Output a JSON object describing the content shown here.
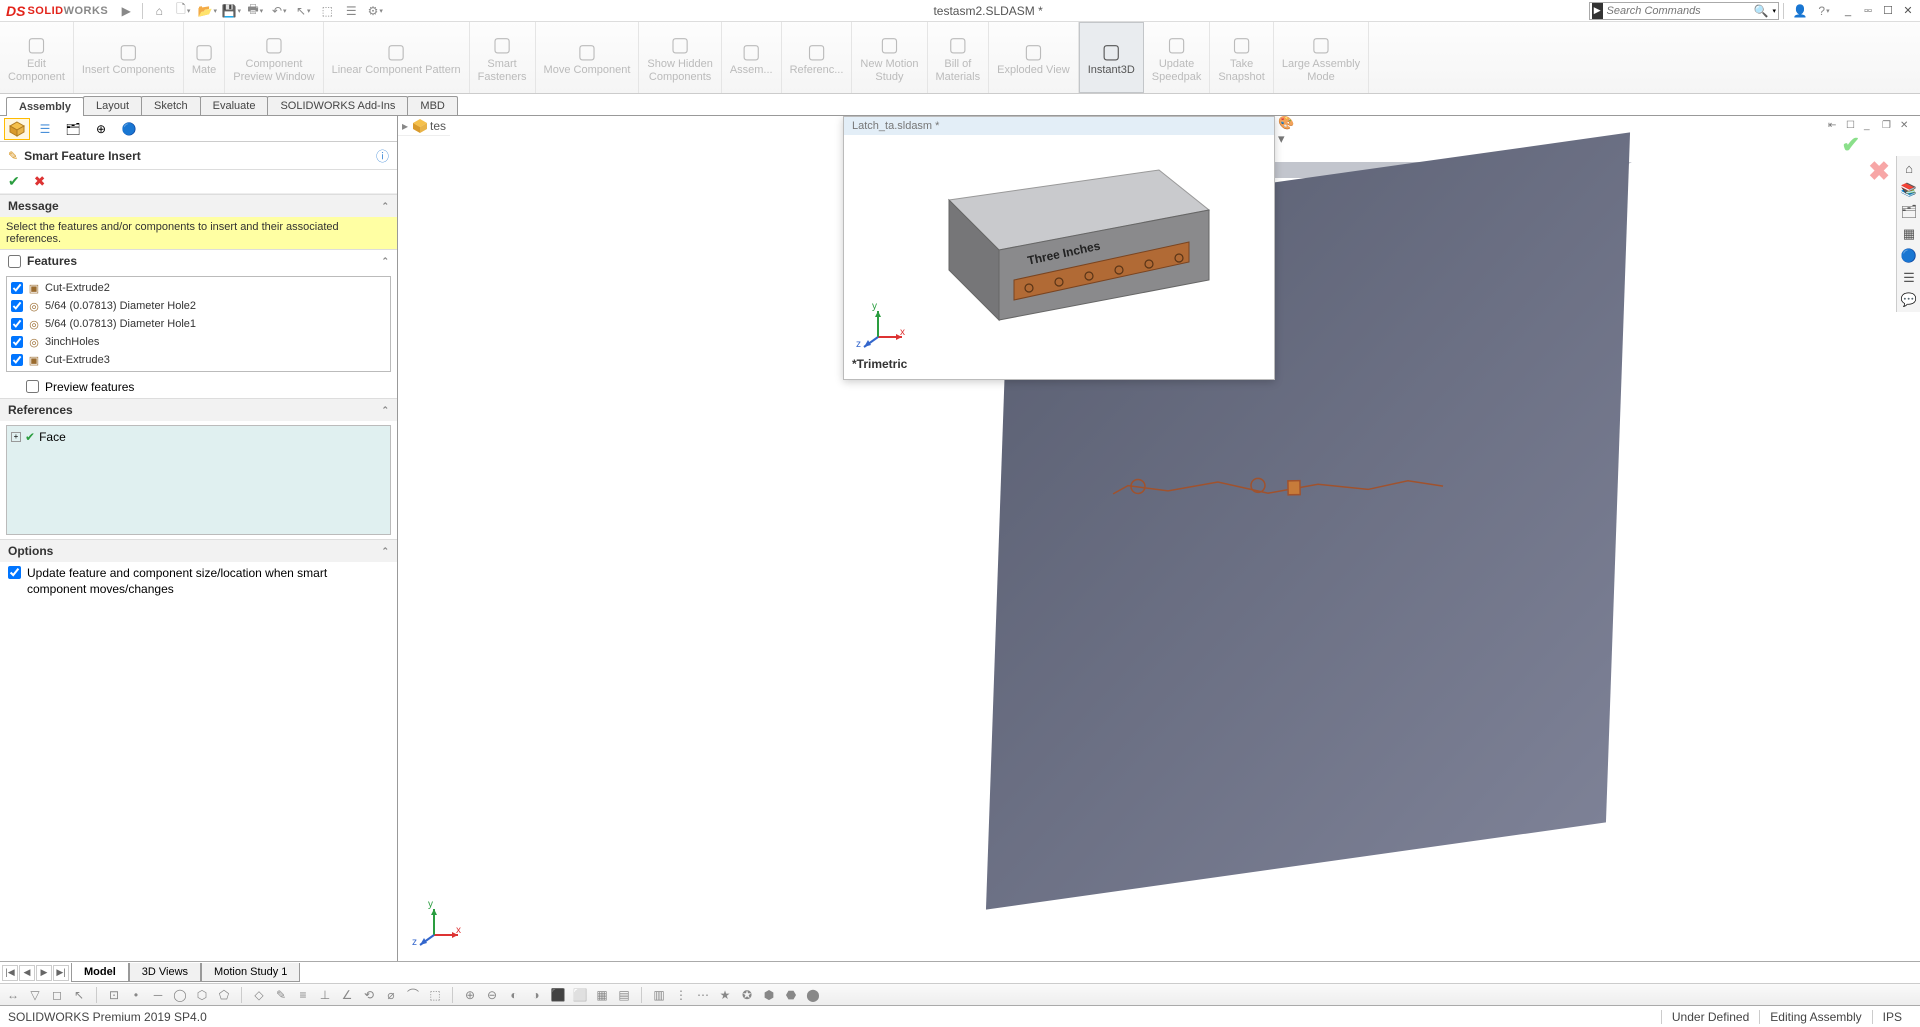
{
  "app": {
    "logo1": "SOLID",
    "logo2": "WORKS",
    "docTitle": "testasm2.SLDASM *",
    "searchPlaceholder": "Search Commands"
  },
  "ribbon": [
    {
      "label": "Edit\nComponent",
      "enabled": false
    },
    {
      "label": "Insert Components",
      "enabled": false
    },
    {
      "label": "Mate",
      "enabled": false
    },
    {
      "label": "Component\nPreview Window",
      "enabled": false
    },
    {
      "label": "Linear Component Pattern",
      "enabled": false
    },
    {
      "label": "Smart\nFasteners",
      "enabled": false
    },
    {
      "label": "Move Component",
      "enabled": false
    },
    {
      "label": "Show Hidden\nComponents",
      "enabled": false
    },
    {
      "label": "Assem...",
      "enabled": false
    },
    {
      "label": "Referenc...",
      "enabled": false
    },
    {
      "label": "New Motion\nStudy",
      "enabled": false
    },
    {
      "label": "Bill of\nMaterials",
      "enabled": false
    },
    {
      "label": "Exploded View",
      "enabled": false
    },
    {
      "label": "Instant3D",
      "enabled": true,
      "active": true
    },
    {
      "label": "Update\nSpeedpak",
      "enabled": false
    },
    {
      "label": "Take\nSnapshot",
      "enabled": false
    },
    {
      "label": "Large Assembly\nMode",
      "enabled": false
    }
  ],
  "tabs": [
    "Assembly",
    "Layout",
    "Sketch",
    "Evaluate",
    "SOLIDWORKS Add-Ins",
    "MBD"
  ],
  "activeTab": "Assembly",
  "panel": {
    "title": "Smart Feature Insert",
    "msgHeader": "Message",
    "message": "Select the features and/or components to insert and their associated references.",
    "featHeader": "Features",
    "features": [
      {
        "name": "Cut-Extrude2",
        "checked": true,
        "type": "cut"
      },
      {
        "name": "5/64 (0.07813) Diameter Hole2",
        "checked": true,
        "type": "hole"
      },
      {
        "name": "5/64 (0.07813) Diameter Hole1",
        "checked": true,
        "type": "hole"
      },
      {
        "name": "3inchHoles",
        "checked": true,
        "type": "hole"
      },
      {
        "name": "Cut-Extrude3",
        "checked": true,
        "type": "cut"
      }
    ],
    "previewLabel": "Preview features",
    "refHeader": "References",
    "refItem": "Face",
    "optHeader": "Options",
    "optText": "Update feature and component size/location when smart component moves/changes"
  },
  "breadcrumb": "tes",
  "preview": {
    "winTitle": "Latch_ta.sldasm *",
    "viewLabel": "*Trimetric",
    "blockText1": "Three Inches"
  },
  "bottomTabs": [
    "Model",
    "3D Views",
    "Motion Study 1"
  ],
  "activeBottomTab": "Model",
  "status": {
    "product": "SOLIDWORKS Premium 2019 SP4.0",
    "def": "Under Defined",
    "mode": "Editing Assembly",
    "units": "IPS"
  }
}
